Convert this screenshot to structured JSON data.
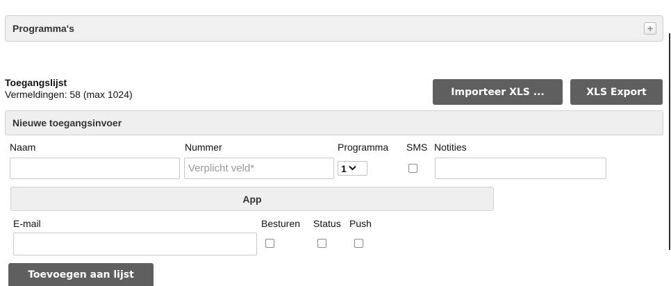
{
  "programs_panel": {
    "title": "Programma's",
    "expand_glyph": "+"
  },
  "access_list": {
    "title": "Toegangslijst",
    "entries_text": "Vermeldingen: 58 (max 1024)",
    "import_label": "Importeer XLS ...",
    "export_label": "XLS Export"
  },
  "new_entry": {
    "title": "Nieuwe toegangsinvoer",
    "labels": {
      "name": "Naam",
      "number": "Nummer",
      "program": "Programma",
      "sms": "SMS",
      "notes": "Notities"
    },
    "name_value": "",
    "number_placeholder": "Verplicht veld*",
    "program_selected": "1",
    "sms_checked": false,
    "notes_value": ""
  },
  "app_section": {
    "title": "App",
    "labels": {
      "email": "E-mail",
      "control": "Besturen",
      "status": "Status",
      "push": "Push"
    },
    "email_value": "",
    "control_checked": false,
    "status_checked": false,
    "push_checked": false
  },
  "add_button_label": "Toevoegen aan lijst",
  "icons": {
    "expand": "plus-icon",
    "dropdown": "chevron-down-icon"
  }
}
